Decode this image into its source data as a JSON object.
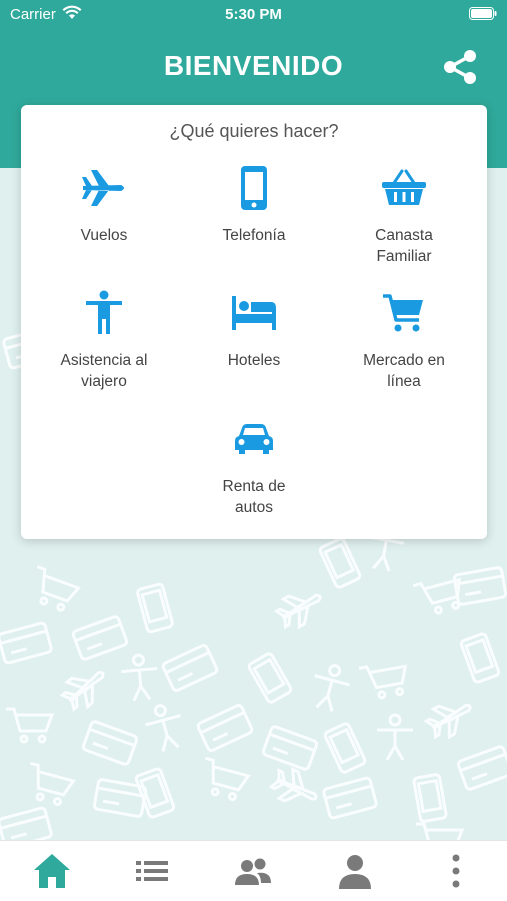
{
  "status_bar": {
    "carrier": "Carrier",
    "time": "5:30 PM"
  },
  "header": {
    "title": "BIENVENIDO",
    "share_icon": "share-icon"
  },
  "menu": {
    "question": "¿Qué quieres hacer?",
    "items": [
      {
        "label": "Vuelos",
        "icon": "airplane-icon"
      },
      {
        "label": "Telefonía",
        "icon": "phone-icon"
      },
      {
        "label": "Canasta\nFamiliar",
        "icon": "basket-icon"
      },
      {
        "label": "Asistencia al\nviajero",
        "icon": "person-icon"
      },
      {
        "label": "Hoteles",
        "icon": "bed-icon"
      },
      {
        "label": "Mercado en\nlínea",
        "icon": "cart-icon"
      },
      {
        "label": "Renta de\nautos",
        "icon": "car-icon"
      }
    ]
  },
  "tabbar": {
    "tabs": [
      {
        "icon": "home-icon",
        "active": true
      },
      {
        "icon": "list-icon",
        "active": false
      },
      {
        "icon": "group-icon",
        "active": false
      },
      {
        "icon": "user-icon",
        "active": false
      },
      {
        "icon": "more-icon",
        "active": false
      }
    ]
  },
  "colors": {
    "primary": "#2fa99b",
    "icon_blue": "#1a9ae0",
    "background": "#dff0ef",
    "tab_inactive": "#7a7a7a"
  }
}
